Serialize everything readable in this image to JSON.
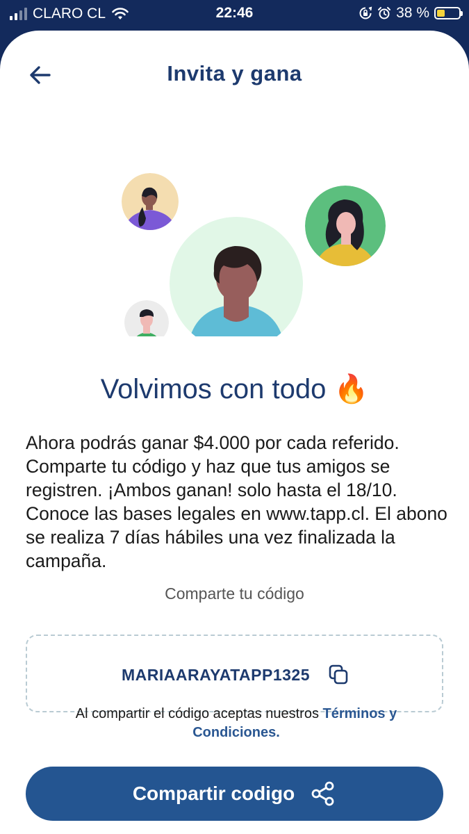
{
  "status_bar": {
    "carrier": "CLARO CL",
    "time": "22:46",
    "battery_percent": "38 %",
    "battery_level": 0.38,
    "icons": [
      "cellular-signal-icon",
      "wifi-icon",
      "rotation-lock-icon",
      "alarm-icon",
      "battery-icon"
    ]
  },
  "header": {
    "title": "Invita y gana",
    "back_icon": "arrow-left-icon"
  },
  "main": {
    "headline": "Volvimos con todo",
    "headline_emoji": "🔥",
    "description": "Ahora podrás ganar $4.000 por cada referido. Comparte tu código y haz que tus amigos se registren. ¡Ambos ganan! solo hasta el 18/10. Conoce las bases legales en www.tapp.cl. El abono se realiza 7 días hábiles una vez finalizada la campaña.",
    "share_label": "Comparte tu código",
    "code": "MARIAARAYATAPP1325",
    "copy_icon": "copy-icon",
    "terms_prefix": "Al compartir el código aceptas nuestros ",
    "terms_link": "Términos y Condiciones."
  },
  "cta": {
    "label": "Compartir codigo",
    "icon": "share-icon"
  },
  "colors": {
    "status_bar_bg": "#132a5c",
    "primary": "#245591",
    "title_text": "#1d3a6e",
    "link": "#2a5792",
    "dashed_border": "#b9cbd3"
  }
}
